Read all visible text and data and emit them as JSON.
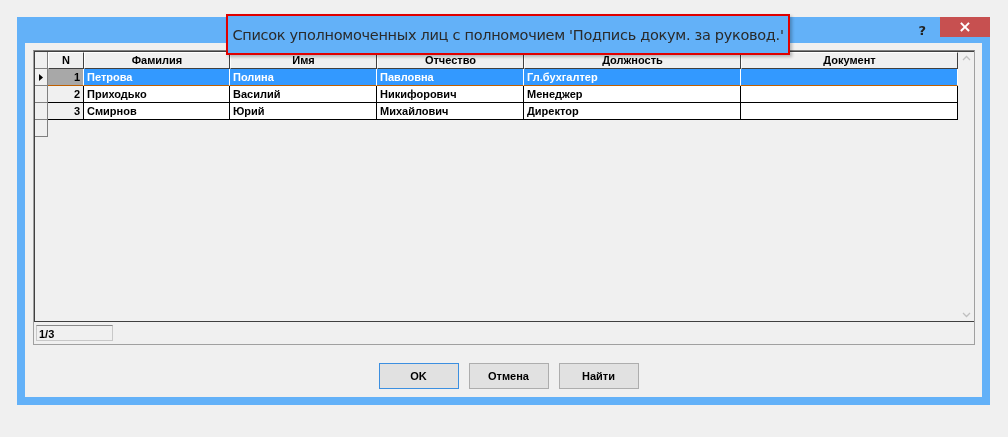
{
  "window": {
    "title": "Список уполномоченных лиц с полномочием 'Подпись докум. за руковод.'",
    "help": "?",
    "close": "×"
  },
  "table": {
    "columns": [
      "N",
      "Фамилия",
      "Имя",
      "Отчество",
      "Должность",
      "Документ"
    ],
    "rows": [
      {
        "selected": true,
        "cells": [
          "1",
          "Петрова",
          "Полина",
          "Павловна",
          "Гл.бухгалтер",
          ""
        ]
      },
      {
        "selected": false,
        "cells": [
          "2",
          "Приходько",
          "Василий",
          "Никифорович",
          "Менеджер",
          ""
        ]
      },
      {
        "selected": false,
        "cells": [
          "3",
          "Смирнов",
          "Юрий",
          "Михайлович",
          "Директор",
          ""
        ]
      }
    ]
  },
  "status_bar": {
    "position": "1/3"
  },
  "buttons": [
    {
      "label": "OK",
      "selected": true
    },
    {
      "label": "Отмена",
      "selected": false
    },
    {
      "label": "Найти",
      "selected": false
    }
  ]
}
